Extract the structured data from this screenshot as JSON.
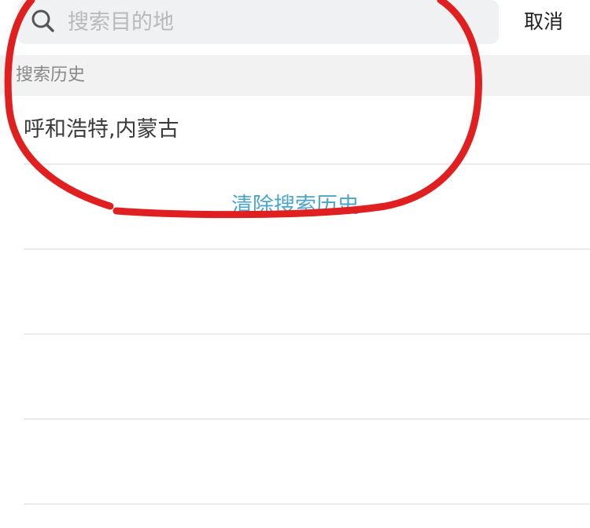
{
  "search": {
    "placeholder": "搜索目的地",
    "value": "",
    "cancel_label": "取消"
  },
  "history": {
    "header_label": "搜索历史",
    "items": [
      {
        "label": "呼和浩特,内蒙古"
      }
    ],
    "clear_label": "清除搜索历史"
  },
  "colors": {
    "accent": "#4aa6c8",
    "annotation": "#e02020",
    "search_bg": "#f0f1f3",
    "section_bg": "#f2f2f2"
  },
  "icons": {
    "search": "search-icon"
  }
}
